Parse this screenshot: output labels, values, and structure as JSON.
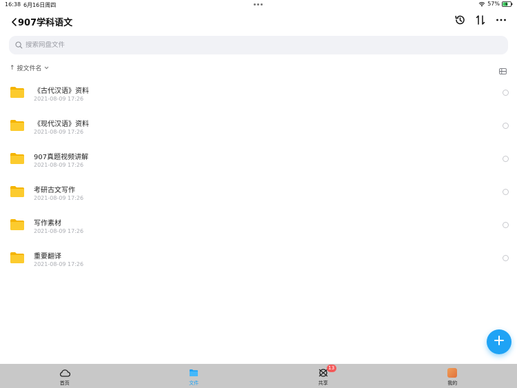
{
  "status_bar": {
    "time": "16:38",
    "date": "6月16日周四",
    "battery_percent": "57%"
  },
  "header": {
    "title": "907学科语文"
  },
  "search": {
    "placeholder": "搜索网盘文件"
  },
  "sort": {
    "label": "按文件名"
  },
  "files": [
    {
      "name": "《古代汉语》资料",
      "date": "2021-08-09 17:26"
    },
    {
      "name": "《现代汉语》资料",
      "date": "2021-08-09 17:26"
    },
    {
      "name": "907真题视频讲解",
      "date": "2021-08-09 17:26"
    },
    {
      "name": "考研古文写作",
      "date": "2021-08-09 17:26"
    },
    {
      "name": "写作素材",
      "date": "2021-08-09 17:26"
    },
    {
      "name": "重要翻译",
      "date": "2021-08-09 17:26"
    }
  ],
  "tabs": [
    {
      "label": "首页",
      "icon": "cloud-icon"
    },
    {
      "label": "文件",
      "icon": "folder-icon"
    },
    {
      "label": "共享",
      "icon": "share-icon",
      "badge": "13"
    },
    {
      "label": "我的",
      "icon": "avatar"
    }
  ],
  "colors": {
    "accent": "#1fa3f5",
    "folder": "#f9c11f",
    "badge": "#f35a5a"
  }
}
